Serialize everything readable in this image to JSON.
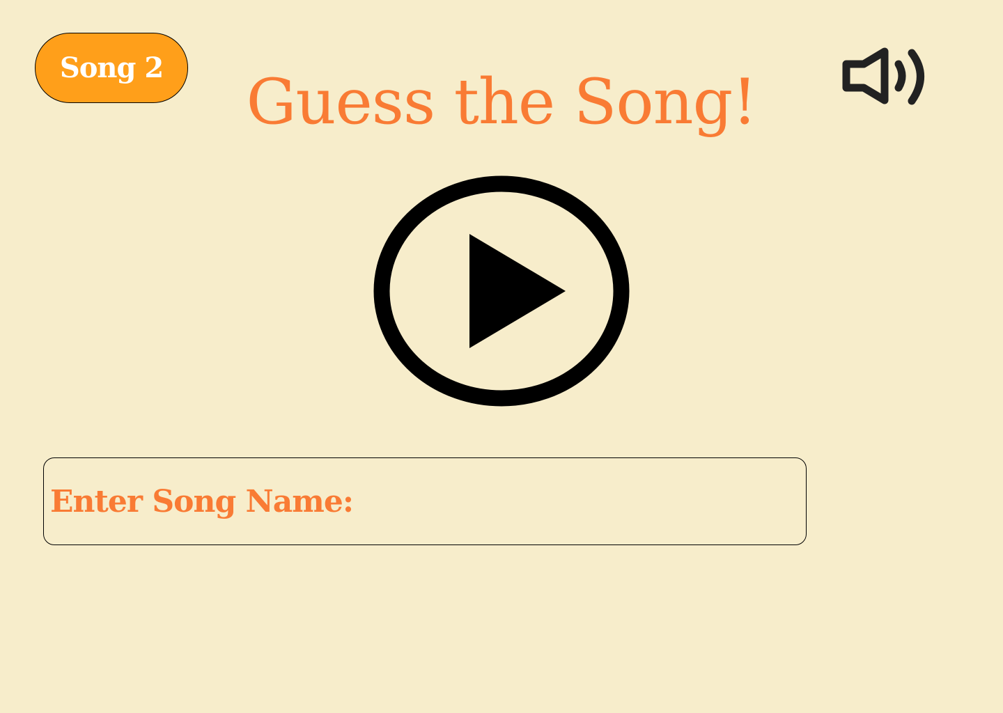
{
  "song_badge": {
    "label": "Song 2"
  },
  "page": {
    "title": "Guess the Song!"
  },
  "controls": {
    "volume_icon": "speaker-volume-icon",
    "play_icon": "play-circle-icon"
  },
  "answer": {
    "label": "Enter Song Name:",
    "value": "",
    "placeholder": ""
  },
  "colors": {
    "background": "#F7EDCB",
    "accent": "#F97B34",
    "badge": "#FF9F1A",
    "icon": "#000000"
  }
}
